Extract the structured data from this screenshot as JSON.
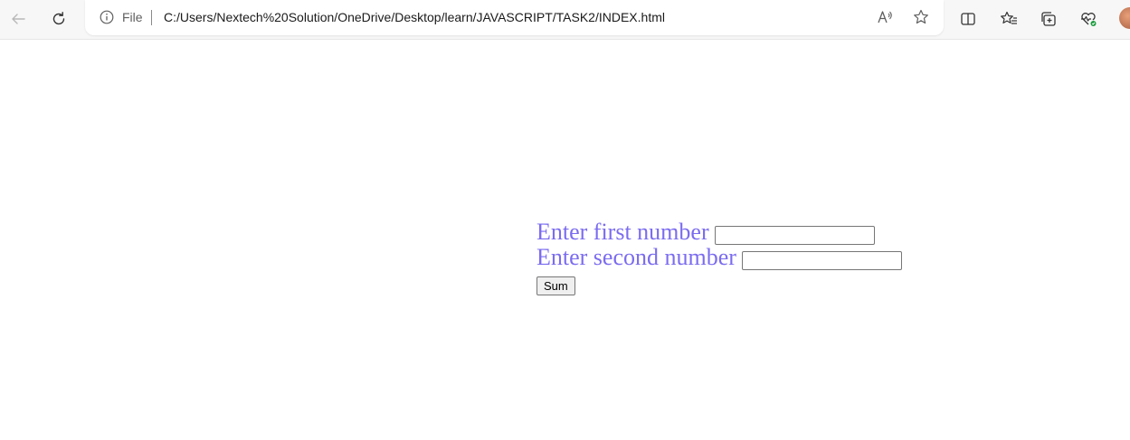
{
  "browser": {
    "address_bar": {
      "scheme_label": "File",
      "url": "C:/Users/Nextech%20Solution/OneDrive/Desktop/learn/JAVASCRIPT/TASK2/INDEX.html"
    },
    "icons": {
      "back": "back-arrow-icon",
      "refresh": "refresh-icon",
      "info": "info-icon",
      "read_aloud": "read-aloud-icon",
      "favorite": "star-icon",
      "split_screen": "split-screen-icon",
      "favorites": "favorites-icon",
      "collections": "collections-icon",
      "browser_essentials": "heart-pulse-icon",
      "profile": "avatar"
    }
  },
  "form": {
    "first_label": "Enter first number",
    "first_value": "",
    "second_label": "Enter second number",
    "second_value": "",
    "sum_button": "Sum"
  },
  "colors": {
    "label": "#7b6cf0",
    "toolbar": "#f7f7f7"
  }
}
